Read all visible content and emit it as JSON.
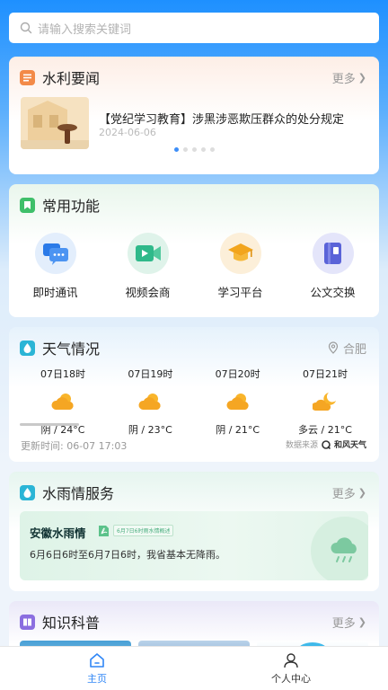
{
  "search": {
    "placeholder": "请输入搜索关键词",
    "icon": "search-icon"
  },
  "news": {
    "title": "水利要闻",
    "more": "更多",
    "headline": "【党纪学习教育】涉黑涉恶欺压群众的处分规定",
    "date": "2024-06-06",
    "pages": 5,
    "active_page": 1
  },
  "functions": {
    "title": "常用功能",
    "items": [
      {
        "label": "即时通讯",
        "icon": "chat-icon"
      },
      {
        "label": "视频会商",
        "icon": "video-icon"
      },
      {
        "label": "学习平台",
        "icon": "graduation-cap-icon"
      },
      {
        "label": "公文交换",
        "icon": "document-icon"
      }
    ]
  },
  "weather": {
    "title": "天气情况",
    "location": "合肥",
    "forecast": [
      {
        "time": "07日18时",
        "desc": "阴 / 24°C",
        "icon": "overcast-icon"
      },
      {
        "time": "07日19时",
        "desc": "阴 / 23°C",
        "icon": "overcast-icon"
      },
      {
        "time": "07日20时",
        "desc": "阴 / 21°C",
        "icon": "overcast-icon"
      },
      {
        "time": "07日21时",
        "desc": "多云 / 21°C",
        "icon": "partly-cloudy-night-icon"
      }
    ],
    "updated": "更新时间:  06-07 17:03",
    "source_label": "数据来源",
    "source_name": "和风天气"
  },
  "rain": {
    "title": "水雨情服务",
    "more": "更多",
    "card_title": "安徽水雨情",
    "tag": "6月7日6时雨水情概述",
    "summary": "6月6日6时至6月7日6时，我省基本无降雨。"
  },
  "knowledge": {
    "title": "知识科普",
    "more": "更多"
  },
  "tabbar": [
    {
      "label": "主页",
      "icon": "home-icon",
      "active": true
    },
    {
      "label": "个人中心",
      "icon": "user-icon",
      "active": false
    }
  ],
  "colors": {
    "accent": "#3d8ef8",
    "active_tab": "#2f86f6",
    "inactive_tab": "#333333"
  }
}
